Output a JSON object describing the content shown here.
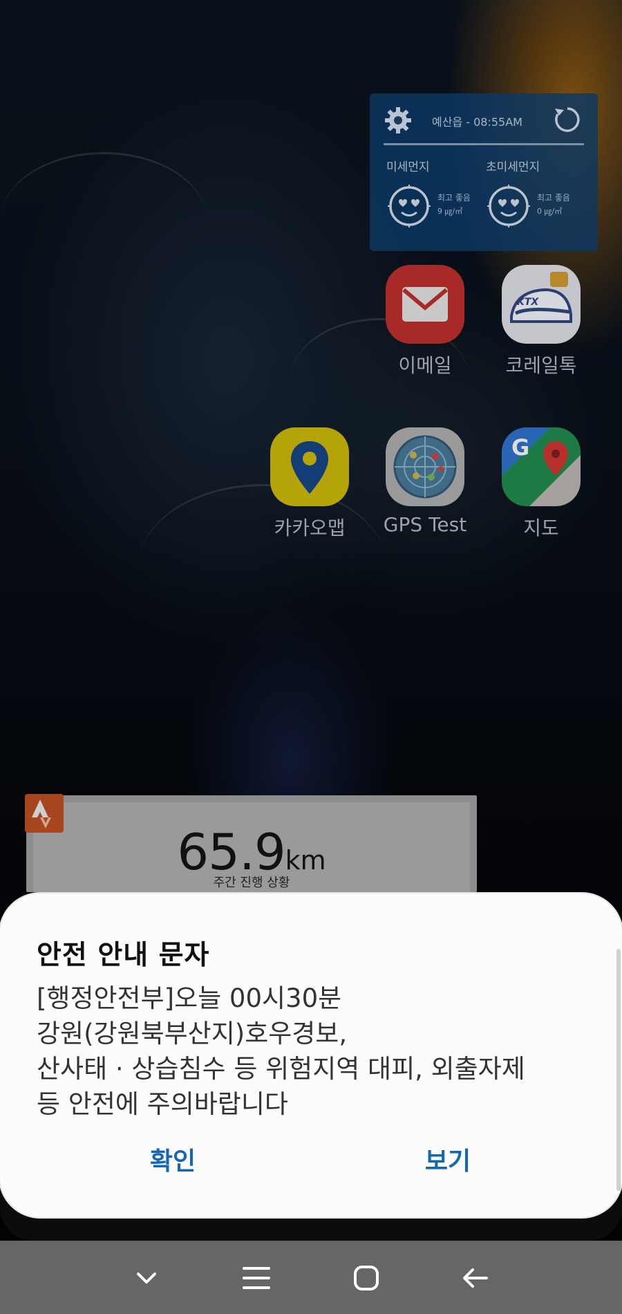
{
  "air_widget": {
    "title": "예산읍 - 08:55AM",
    "pm10": {
      "label": "미세먼지",
      "status": "최고 좋음",
      "value": "9 ㎍/㎥"
    },
    "pm25": {
      "label": "초미세먼지",
      "status": "최고 좋음",
      "value": "0 ㎍/㎥"
    },
    "icons": {
      "settings": "gear-icon",
      "refresh": "refresh-icon",
      "face": "heart-eyes-face-icon"
    }
  },
  "apps": [
    {
      "label": "이메일",
      "icon": "email-envelope-icon"
    },
    {
      "label": "코레일톡",
      "icon": "ktx-train-icon"
    },
    {
      "label": "카카오맵",
      "icon": "kakao-map-pin-icon"
    },
    {
      "label": "GPS Test",
      "icon": "gps-radar-icon"
    },
    {
      "label": "지도",
      "icon": "google-maps-icon"
    }
  ],
  "strava_widget": {
    "value": "65.9",
    "unit": "km",
    "caption": "주간 진행 상황"
  },
  "alert_dialog": {
    "title": "안전 안내 문자",
    "lines": [
      "[행정안전부]오늘 00시30분",
      "강원(강원북부산지)호우경보,",
      "산사태 · 상습침수 등 위험지역 대피, 외출자제",
      "등 안전에 주의바랍니다"
    ],
    "confirm_label": "확인",
    "view_label": "보기",
    "button_color": "#1567b3"
  },
  "nav_bar": {
    "buttons": [
      "chevron-down-icon",
      "recent-apps-icon",
      "home-icon",
      "back-icon"
    ],
    "background": "#666666"
  }
}
